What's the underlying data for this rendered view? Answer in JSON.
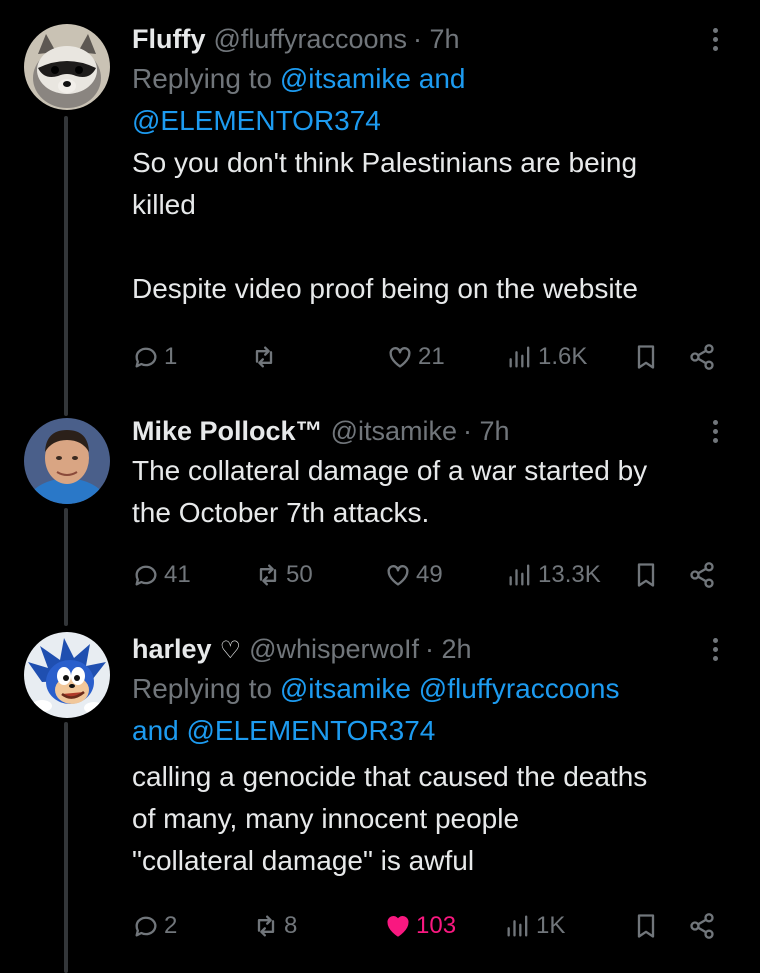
{
  "tweets": [
    {
      "name": "Fluffy",
      "handle": "@fluffyraccoons",
      "time": "· 7h",
      "reply": {
        "prefix": "Replying to ",
        "mention1": "@itsamike",
        "joiner": " and",
        "mention2": "@ELEMENTOR374"
      },
      "text": "So you don't think Palestinians are being\nkilled\n\nDespite video proof being on the website",
      "stats": {
        "replies": "1",
        "reposts": "",
        "likes": "21",
        "views": "1.6K"
      }
    },
    {
      "name": "Mike Pollock™",
      "handle": "@itsamike",
      "time": "· 7h",
      "text": "The collateral damage of a war started by\nthe October 7th attacks.",
      "stats": {
        "replies": "41",
        "reposts": "50",
        "likes": "49",
        "views": "13.3K"
      }
    },
    {
      "name": "harley",
      "name_symbol": "♡",
      "handle": "@whisperwoIf",
      "time": "· 2h",
      "reply": {
        "prefix": "Replying to ",
        "mention1": "@itsamike",
        "mention2": "@fluffyraccoons",
        "joiner": "and ",
        "mention3": "@ELEMENTOR374"
      },
      "text": "calling a genocide that caused the deaths\nof many, many innocent people\n\"collateral damage\" is awful",
      "stats": {
        "replies": "2",
        "reposts": "8",
        "likes": "103",
        "views": "1K"
      }
    }
  ],
  "colors": {
    "background": "#000000",
    "text": "#e7e9ea",
    "muted": "#71767b",
    "link": "#1d9bf0",
    "like": "#f91880"
  }
}
